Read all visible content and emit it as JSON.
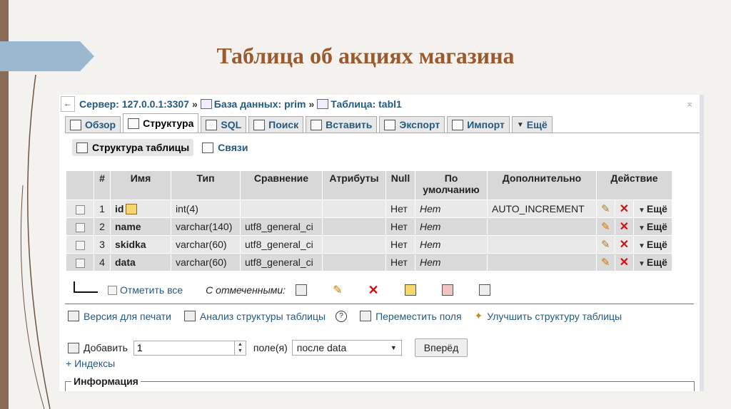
{
  "slide": {
    "title": "Таблица об акциях магазина"
  },
  "breadcrumb": {
    "server": "Сервер: 127.0.0.1:3307",
    "sep": "»",
    "database": "База данных: prim",
    "table": "Таблица: tabl1"
  },
  "tabs": [
    {
      "label": "Обзор",
      "icon": "browse-icon"
    },
    {
      "label": "Структура",
      "icon": "structure-icon",
      "active": true
    },
    {
      "label": "SQL",
      "icon": "sql-icon"
    },
    {
      "label": "Поиск",
      "icon": "search-icon"
    },
    {
      "label": "Вставить",
      "icon": "insert-icon"
    },
    {
      "label": "Экспорт",
      "icon": "export-icon"
    },
    {
      "label": "Импорт",
      "icon": "import-icon"
    },
    {
      "label": "Ещё",
      "icon": "dropdown-icon"
    }
  ],
  "subtabs": [
    {
      "label": "Структура таблицы",
      "active": true
    },
    {
      "label": "Связи"
    }
  ],
  "table": {
    "headers": [
      "#",
      "Имя",
      "Тип",
      "Сравнение",
      "Атрибуты",
      "Null",
      "По умолчанию",
      "Дополнительно",
      "Действие"
    ],
    "rows": [
      {
        "num": "1",
        "name": "id",
        "type": "int(4)",
        "collation": "",
        "attributes": "",
        "null": "Нет",
        "default": "Нет",
        "extra": "AUTO_INCREMENT",
        "more": "Ещё"
      },
      {
        "num": "2",
        "name": "name",
        "type": "varchar(140)",
        "collation": "utf8_general_ci",
        "attributes": "",
        "null": "Нет",
        "default": "Нет",
        "extra": "",
        "more": "Ещё"
      },
      {
        "num": "3",
        "name": "skidka",
        "type": "varchar(60)",
        "collation": "utf8_general_ci",
        "attributes": "",
        "null": "Нет",
        "default": "Нет",
        "extra": "",
        "more": "Ещё"
      },
      {
        "num": "4",
        "name": "data",
        "type": "varchar(60)",
        "collation": "utf8_general_ci",
        "attributes": "",
        "null": "Нет",
        "default": "Нет",
        "extra": "",
        "more": "Ещё"
      }
    ]
  },
  "bulk": {
    "check_all": "Отметить все",
    "with_selected": "С отмеченными:"
  },
  "actions": {
    "print": "Версия для печати",
    "analyze": "Анализ структуры таблицы",
    "move": "Переместить поля",
    "improve": "Улучшить структуру таблицы"
  },
  "add": {
    "label": "Добавить",
    "count": "1",
    "fields": "поле(я)",
    "position": "после data",
    "go": "Вперёд"
  },
  "indexes": "+ Индексы",
  "info": "Информация",
  "colors": {
    "link": "#235a81",
    "title": "#9b5a2e",
    "accent_ribbon": "#9ab8d0"
  }
}
